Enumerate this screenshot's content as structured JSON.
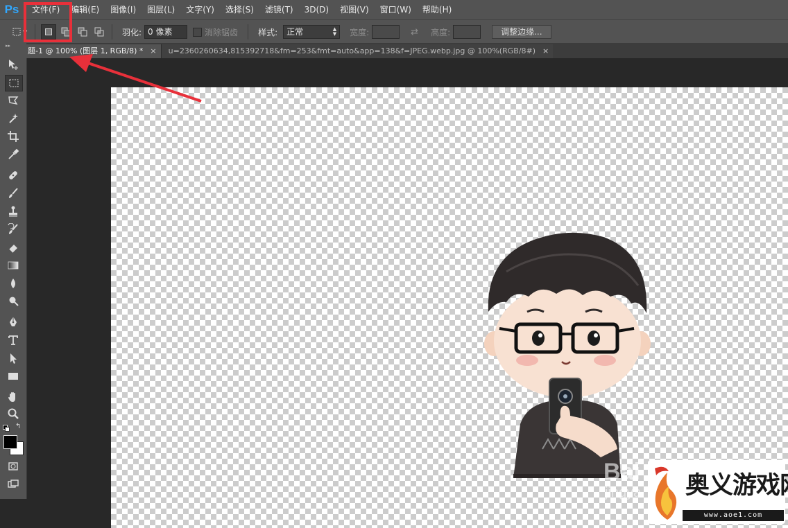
{
  "app": {
    "logo_text": "Ps"
  },
  "menubar": {
    "items": [
      {
        "label": "文件(F)"
      },
      {
        "label": "编辑(E)"
      },
      {
        "label": "图像(I)"
      },
      {
        "label": "图层(L)"
      },
      {
        "label": "文字(Y)"
      },
      {
        "label": "选择(S)"
      },
      {
        "label": "滤镜(T)"
      },
      {
        "label": "3D(D)"
      },
      {
        "label": "视图(V)"
      },
      {
        "label": "窗口(W)"
      },
      {
        "label": "帮助(H)"
      }
    ]
  },
  "options": {
    "feather_label": "羽化:",
    "feather_value": "0 像素",
    "antialias_label": "消除锯齿",
    "style_label": "样式:",
    "style_value": "正常",
    "width_label": "宽度:",
    "height_label": "高度:",
    "refine_edge_label": "调整边缘..."
  },
  "tabs": [
    {
      "label": "题-1 @ 100% (图层 1, RGB/8) *",
      "close": "×"
    },
    {
      "label": "u=2360260634,815392718&fm=253&fmt=auto&app=138&f=JPEG.webp.jpg @ 100%(RGB/8#)",
      "close": "×"
    }
  ],
  "toolbar": {
    "tools": [
      "move-tool",
      "marquee-tool",
      "lasso-tool",
      "magic-wand-tool",
      "crop-tool",
      "eyedropper-tool",
      "healing-brush-tool",
      "brush-tool",
      "clone-stamp-tool",
      "history-brush-tool",
      "eraser-tool",
      "gradient-tool",
      "blur-tool",
      "dodge-tool",
      "pen-tool",
      "type-tool",
      "path-selection-tool",
      "rectangle-tool",
      "hand-tool",
      "zoom-tool"
    ],
    "foreground_color": "#000000",
    "background_color": "#ffffff"
  },
  "watermarks": {
    "baidu_text": "Bai",
    "baidu_sub": "jingya",
    "site_name": "奥义游戏网",
    "site_url": "www.aoe1.com"
  },
  "colors": {
    "highlight": "#e8303a",
    "ps_blue": "#31a8ff"
  }
}
